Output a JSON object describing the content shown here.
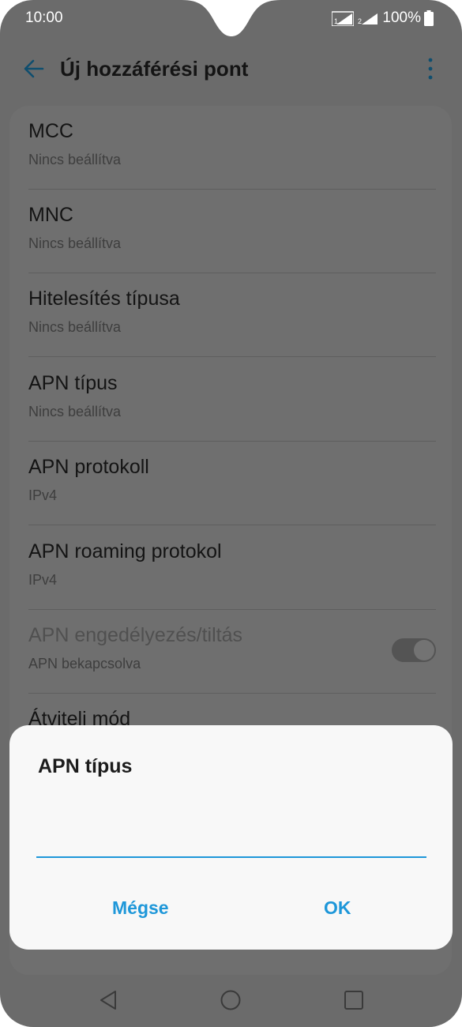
{
  "status": {
    "time": "10:00",
    "battery": "100%"
  },
  "app_bar": {
    "title": "Új hozzáférési pont"
  },
  "settings": [
    {
      "title": "MCC",
      "subtitle": "Nincs beállítva"
    },
    {
      "title": "MNC",
      "subtitle": "Nincs beállítva"
    },
    {
      "title": "Hitelesítés típusa",
      "subtitle": "Nincs beállítva"
    },
    {
      "title": "APN típus",
      "subtitle": "Nincs beállítva"
    },
    {
      "title": "APN protokoll",
      "subtitle": "IPv4"
    },
    {
      "title": "APN roaming protokol",
      "subtitle": "IPv4"
    },
    {
      "title": "APN engedélyezés/tiltás",
      "subtitle": "APN bekapcsolva",
      "toggle_on": true
    },
    {
      "title": "Átviteli mód",
      "subtitle": ""
    }
  ],
  "dialog": {
    "title": "APN típus",
    "input_value": "",
    "cancel_label": "Mégse",
    "ok_label": "OK"
  },
  "colors": {
    "accent": "#1e97d9",
    "dim_overlay": "#6b6b6b",
    "dialog_bg": "#f8f8f8"
  },
  "icons": {
    "back": "arrow-left-icon",
    "menu": "more-vert-icon",
    "nav_back": "triangle-back-icon",
    "nav_home": "circle-home-icon",
    "nav_recent": "square-recents-icon"
  }
}
